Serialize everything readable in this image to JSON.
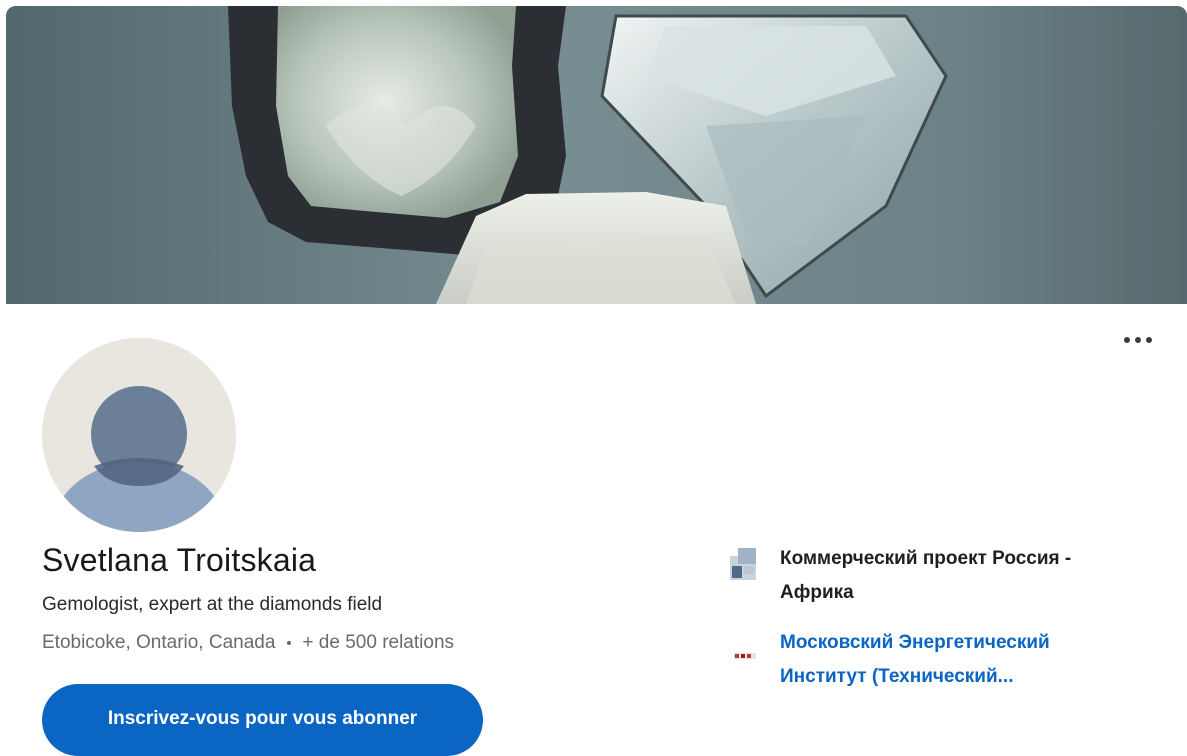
{
  "banner": {
    "icon": "diamond-crystals-photo"
  },
  "menu": {
    "icon": "more-horizontal-icon"
  },
  "avatar": {
    "icon": "default-person-avatar"
  },
  "profile": {
    "name": "Svetlana Troitskaia",
    "headline": "Gemologist, expert at the diamonds field",
    "location": "Etobicoke, Ontario, Canada",
    "connections": "+ de 500 relations"
  },
  "actions": {
    "follow_label": "Inscrivez-vous pour vous abonner"
  },
  "organizations": {
    "company": {
      "line1": "Коммерческий проект Россия -",
      "line2": "Африка",
      "icon": "company-logo"
    },
    "school": {
      "line1": "Московский Энергетический",
      "line2": "Институт (Технический...",
      "icon": "school-logo"
    }
  },
  "colors": {
    "accent": "#0a66c2",
    "text_primary": "#191919",
    "text_secondary": "#6a6a6a",
    "avatar_bg": "#e9e5df",
    "avatar_figure": "#6b7f99"
  }
}
